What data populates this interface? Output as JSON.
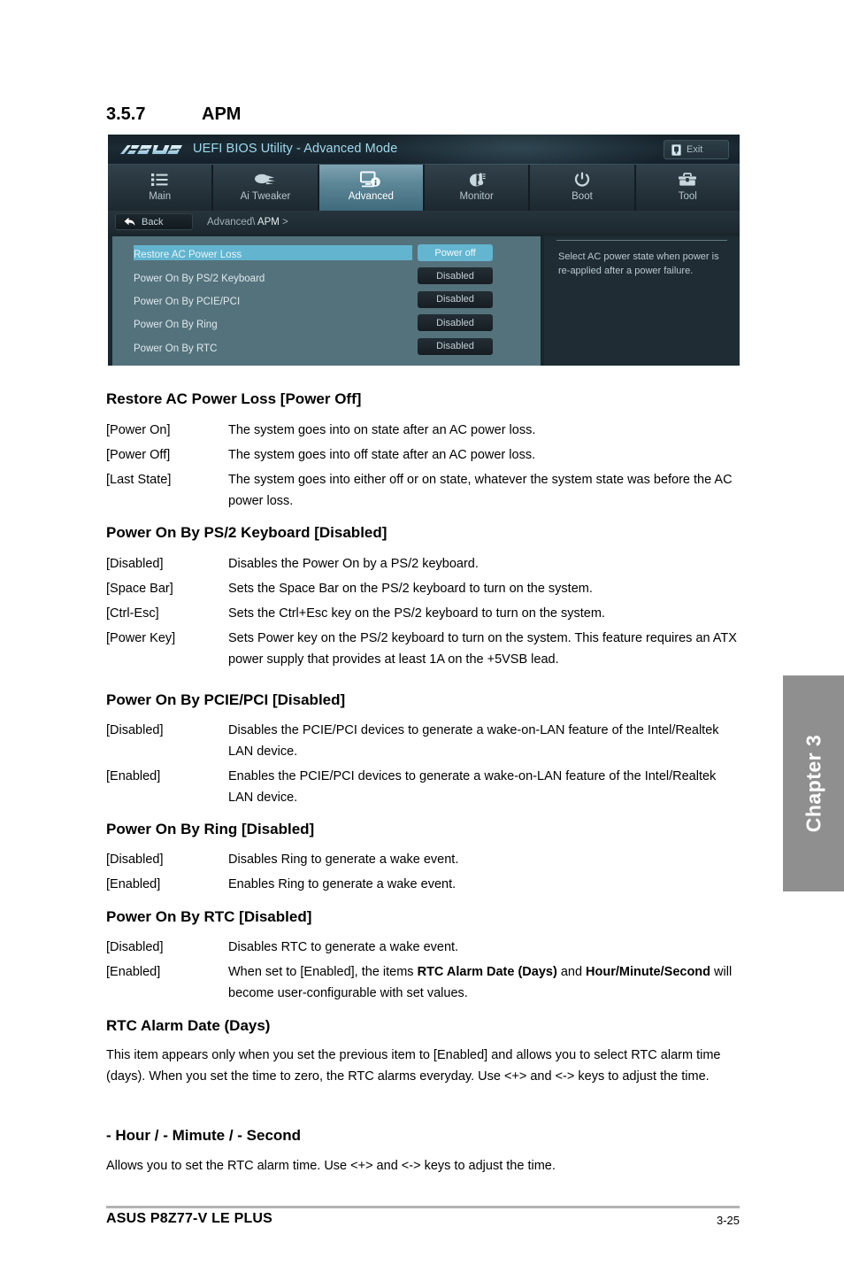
{
  "section": {
    "number": "3.5.7",
    "title": "APM"
  },
  "bios": {
    "brand": "ASUS",
    "title": "UEFI BIOS Utility - Advanced Mode",
    "exit_label": "Exit",
    "exit_icon": "exit-door-icon",
    "tabs": [
      {
        "label": "Main",
        "icon": "list-icon",
        "active": false
      },
      {
        "label": "Ai  Tweaker",
        "icon": "tweaker-icon",
        "active": false
      },
      {
        "label": "Advanced",
        "icon": "monitor-info-icon",
        "active": true
      },
      {
        "label": "Monitor",
        "icon": "gauge-thermometer-icon",
        "active": false
      },
      {
        "label": "Boot",
        "icon": "power-icon",
        "active": false
      },
      {
        "label": "Tool",
        "icon": "toolbox-icon",
        "active": false
      }
    ],
    "back_label": "Back",
    "back_icon": "back-arrow-icon",
    "breadcrumb_prefix": "Advanced\\",
    "breadcrumb_current": "APM",
    "breadcrumb_suffix": ">",
    "items": [
      {
        "label": "Restore AC Power Loss",
        "value": "Power off",
        "selected": true
      },
      {
        "label": "Power On By PS/2 Keyboard",
        "value": "Disabled",
        "selected": false
      },
      {
        "label": "Power On By PCIE/PCI",
        "value": "Disabled",
        "selected": false
      },
      {
        "label": "Power On By Ring",
        "value": "Disabled",
        "selected": false
      },
      {
        "label": "Power On By RTC",
        "value": "Disabled",
        "selected": false
      }
    ],
    "help_text": "Select AC power state when power is re-applied after a power failure.",
    "colors": {
      "highlight": "#62b4cf",
      "panel": "#54727c",
      "title_text": "#9fd9ec"
    }
  },
  "sections": [
    {
      "heading": "Restore AC Power Loss [Power Off]",
      "defs": [
        {
          "term": "[Power On]",
          "desc": "The system goes into on state after an AC power loss."
        },
        {
          "term": "[Power Off]",
          "desc": "The system goes into off state after an AC power loss."
        },
        {
          "term": "[Last State]",
          "desc": "The system goes into either off or on state, whatever the system state was before the AC power loss."
        }
      ]
    },
    {
      "heading": "Power On By PS/2 Keyboard [Disabled]",
      "defs": [
        {
          "term": "[Disabled]",
          "desc": "Disables the Power On by a PS/2 keyboard."
        },
        {
          "term": "[Space Bar]",
          "desc": "Sets the Space Bar on the PS/2 keyboard to turn on the system."
        },
        {
          "term": "[Ctrl-Esc]",
          "desc": "Sets the Ctrl+Esc key on the PS/2 keyboard to turn on the system."
        },
        {
          "term": "[Power Key]",
          "desc": "Sets Power key on the PS/2 keyboard to turn on the system. This feature requires an ATX power supply that provides at least 1A on the +5VSB lead."
        }
      ]
    },
    {
      "heading": "Power On By PCIE/PCI [Disabled]",
      "defs": [
        {
          "term": "[Disabled]",
          "desc": "Disables the PCIE/PCI devices to generate a wake-on-LAN feature of the Intel/Realtek LAN device."
        },
        {
          "term": "[Enabled]",
          "desc": "Enables the PCIE/PCI devices to generate a wake-on-LAN feature of the Intel/Realtek LAN device."
        }
      ]
    },
    {
      "heading": "Power On By Ring [Disabled]",
      "defs": [
        {
          "term": "[Disabled]",
          "desc": "Disables Ring to generate a wake event."
        },
        {
          "term": "[Enabled]",
          "desc": "Enables Ring to generate a wake event."
        }
      ]
    },
    {
      "heading": "Power On By RTC [Disabled]",
      "defs": [
        {
          "term": "[Disabled]",
          "desc": "Disables RTC to generate a wake event."
        }
      ],
      "rtc_enabled_term": "[Enabled]",
      "rtc_enabled_desc_1": "When set to [Enabled], the items ",
      "rtc_enabled_bold_1": "RTC Alarm Date (Days)",
      "rtc_enabled_desc_2": " and ",
      "rtc_enabled_bold_2": "Hour/Minute/Second",
      "rtc_enabled_desc_3": " will become user-configurable with set values."
    },
    {
      "heading": "RTC Alarm Date (Days)",
      "paragraph": "This item appears only when you set the previous item to [Enabled] and allows you to select RTC alarm time (days). When you set the time to zero, the RTC alarms everyday. Use <+> and <-> keys to adjust the time."
    },
    {
      "heading": "- Hour / - Mimute / - Second",
      "paragraph": "Allows you to set the RTC alarm time. Use <+> and <-> keys to adjust the time."
    }
  ],
  "chapter_tab": {
    "label": "Chapter 3"
  },
  "footer": {
    "left": "ASUS P8Z77-V LE PLUS",
    "right": "3-25"
  }
}
